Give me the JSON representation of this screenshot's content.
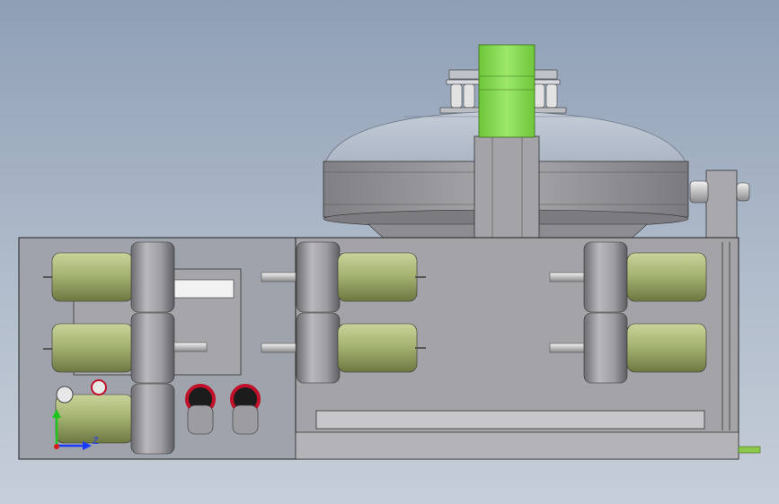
{
  "triad": {
    "z_label": "Z",
    "colors": {
      "x": "#1a3cff",
      "y": "#1fc41f",
      "z": "#1a3cff",
      "origin": "#d81b1b"
    }
  },
  "palette": {
    "background_top": "#8f9fb6",
    "background_bottom": "#c6ced9",
    "motor_body": "#a6b473",
    "gearbox": "#a7a7a7",
    "frame": "#9a9aa0",
    "column_accent": "#8ee05a",
    "dome": "#b7c0cd",
    "bumper_ring": "#c0102a",
    "shaft": "#d2d2d2"
  }
}
